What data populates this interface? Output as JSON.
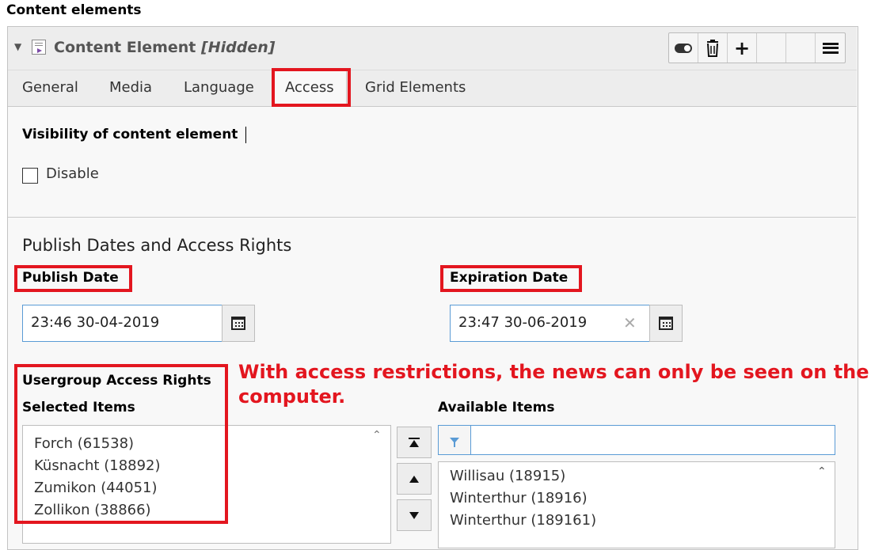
{
  "section_title": "Content elements",
  "element": {
    "title": "Content Element",
    "status": "[Hidden]"
  },
  "tabs": [
    {
      "label": "General"
    },
    {
      "label": "Media"
    },
    {
      "label": "Language"
    },
    {
      "label": "Access"
    },
    {
      "label": "Grid Elements"
    }
  ],
  "active_tab": "Access",
  "visibility": {
    "heading": "Visibility of content element",
    "disable_label": "Disable",
    "disable_checked": false
  },
  "publish": {
    "heading": "Publish Dates and Access Rights",
    "publish_label": "Publish Date",
    "publish_value": "23:46 30-04-2019",
    "expiration_label": "Expiration Date",
    "expiration_value": "23:47 30-06-2019"
  },
  "access": {
    "usergroup_label": "Usergroup Access Rights",
    "selected_label": "Selected Items",
    "available_label": "Available Items",
    "selected_items": [
      "Forch (61538)",
      "Küsnacht (18892)",
      "Zumikon (44051)",
      "Zollikon (38866)"
    ],
    "available_items": [
      "Willisau (18915)",
      "Winterthur (18916)",
      "Winterthur (189161)"
    ],
    "filter_placeholder": ""
  },
  "annotation": {
    "line1": "With access restrictions, the news can only be seen on the",
    "line2": "computer."
  },
  "colors": {
    "highlight": "#e3161f",
    "focus": "#5a9bd5",
    "hidden_icon": "#7b4aa6"
  },
  "icons": [
    "toggle-icon",
    "trash-icon",
    "plus-icon",
    "menu-icon",
    "calendar-icon",
    "clear-icon",
    "filter-icon",
    "move-top-icon",
    "move-up-icon",
    "move-down-icon"
  ]
}
